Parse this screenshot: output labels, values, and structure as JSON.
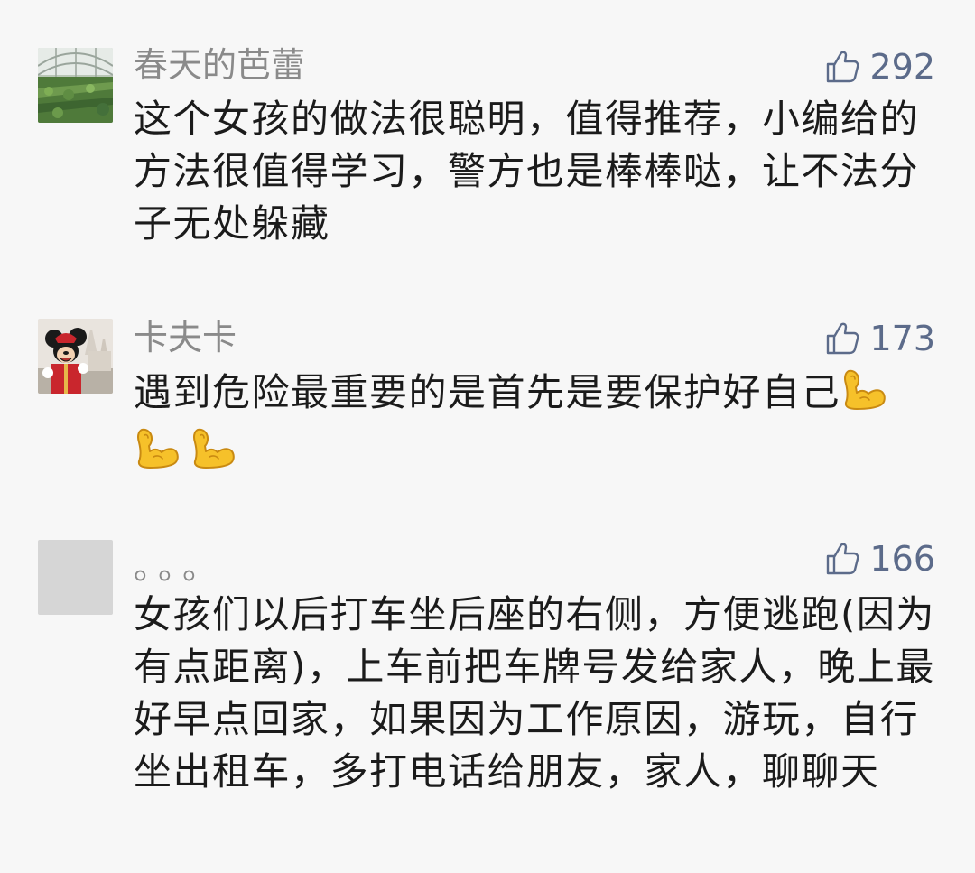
{
  "comments": [
    {
      "nickname": "春天的芭蕾",
      "likes": "292",
      "text": "这个女孩的做法很聪明，值得推荐，小编给的方法很值得学习，警方也是棒棒哒，让不法分子无处躲藏",
      "avatar": "greenhouse-photo"
    },
    {
      "nickname": "卡夫卡",
      "likes": "173",
      "text": "遇到危险最重要的是首先是要保护好自己",
      "emojis": [
        "flexed-biceps",
        "flexed-biceps",
        "flexed-biceps"
      ],
      "avatar": "mickey-mouse-photo"
    },
    {
      "nickname": "。。。",
      "likes": "166",
      "text": "女孩们以后打车坐后座的右侧，方便逃跑(因为有点距离)，上车前把车牌号发给家人，晚上最好早点回家，如果因为工作原因，游玩，自行坐出租车，多打电话给朋友，家人，聊聊天",
      "avatar": "gray-placeholder"
    }
  ],
  "colors": {
    "background": "#f7f7f7",
    "nickname": "#8a8a8a",
    "like": "#5c6b8a",
    "text": "#1b1b1b"
  }
}
